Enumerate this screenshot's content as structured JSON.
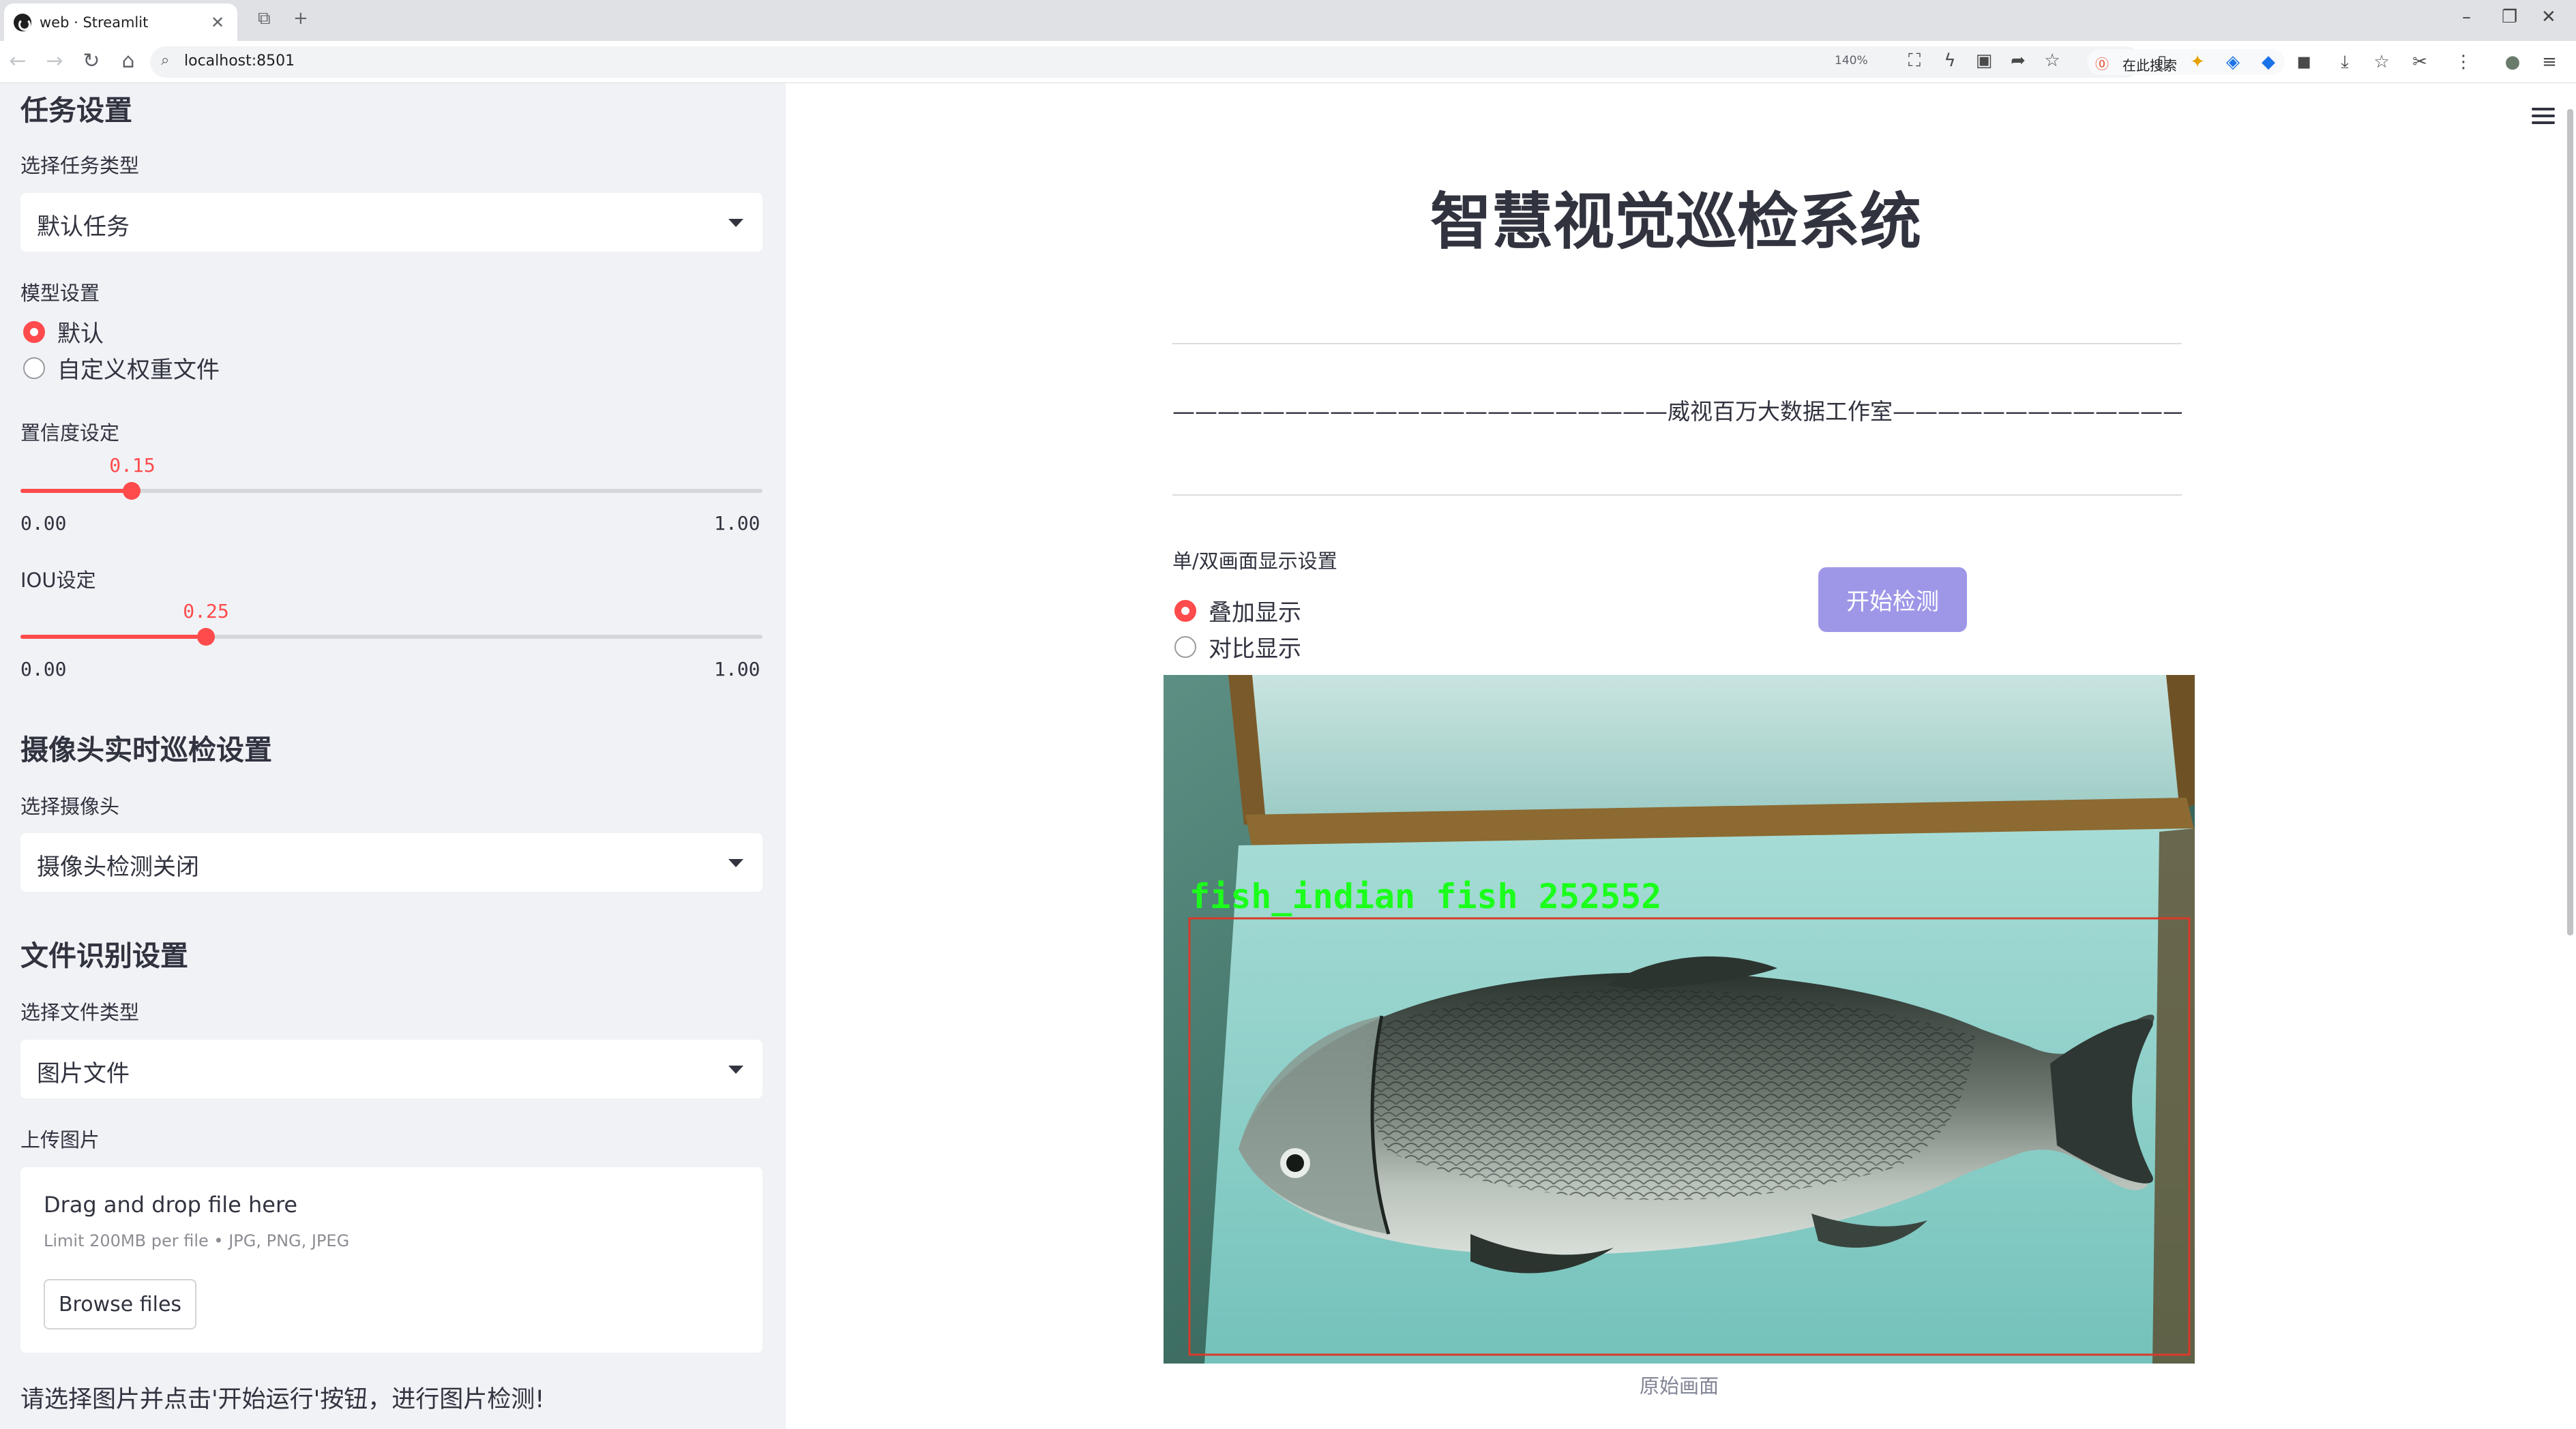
{
  "browser": {
    "tab_title": "web · Streamlit",
    "url": "localhost:8501",
    "zoom": "140%",
    "search_placeholder": "在此搜索"
  },
  "sidebar": {
    "task_section_title": "任务设置",
    "task_type_label": "选择任务类型",
    "task_type_value": "默认任务",
    "model_label": "模型设置",
    "model_options": [
      "默认",
      "自定义权重文件"
    ],
    "model_selected": "默认",
    "confidence_label": "置信度设定",
    "confidence_value": "0.15",
    "confidence_min": "0.00",
    "confidence_max": "1.00",
    "iou_label": "IOU设定",
    "iou_value": "0.25",
    "iou_min": "0.00",
    "iou_max": "1.00",
    "camera_section_title": "摄像头实时巡检设置",
    "camera_label": "选择摄像头",
    "camera_value": "摄像头检测关闭",
    "file_section_title": "文件识别设置",
    "file_type_label": "选择文件类型",
    "file_type_value": "图片文件",
    "upload_label": "上传图片",
    "upload_title": "Drag and drop file here",
    "upload_limit": "Limit 200MB per file • JPG, PNG, JPEG",
    "browse_label": "Browse files",
    "note": "请选择图片并点击'开始运行'按钮，进行图片检测!"
  },
  "main": {
    "title": "智慧视觉巡检系统",
    "studio_line": "——————————————————————威视百万大数据工作室———————————————————————",
    "display_mode_label": "单/双画面显示设置",
    "display_mode_options": [
      "叠加显示",
      "对比显示"
    ],
    "display_mode_selected": "叠加显示",
    "start_button": "开始检测",
    "detection_label": "fish_indian fish 252552",
    "image_caption": "原始画面"
  },
  "colors": {
    "accent": "#ff4b4b",
    "button": "#9e97e8",
    "detection_text": "#1bff1b",
    "detection_box": "#d83a2a"
  }
}
